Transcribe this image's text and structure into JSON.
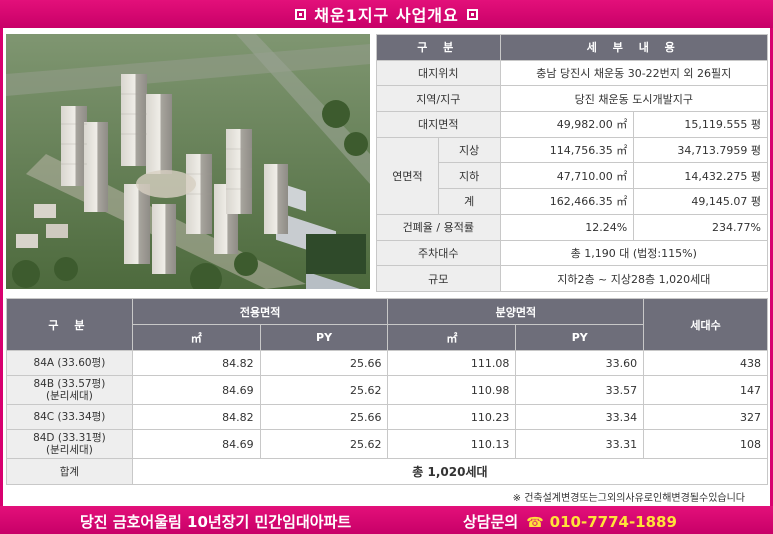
{
  "header": {
    "title": "채운1지구 사업개요"
  },
  "spec": {
    "head_label": "구 분",
    "head_content": "세 부 내 용",
    "location_label": "대지위치",
    "location_value": "충남 당진시 채운동 30-22번지 외 26필지",
    "district_label": "지역/지구",
    "district_value": "당진 채운동 도시개발지구",
    "site_area_label": "대지면적",
    "site_area_m2": "49,982.00 ㎡",
    "site_area_py": "15,119.555 평",
    "gfa_label": "연면적",
    "above_label": "지상",
    "above_m2": "114,756.35 ㎡",
    "above_py": "34,713.7959 평",
    "below_label": "지하",
    "below_m2": "47,710.00 ㎡",
    "below_py": "14,432.275 평",
    "sum_label": "계",
    "sum_m2": "162,466.35 ㎡",
    "sum_py": "49,145.07 평",
    "ratio_label": "건폐율 / 용적률",
    "coverage": "12.24%",
    "far": "234.77%",
    "parking_label": "주차대수",
    "parking_value": "총 1,190 대 (법정:115%)",
    "scale_label": "규모",
    "scale_value": "지하2층 ~ 지상28층  1,020세대"
  },
  "units": {
    "head_label": "구 분",
    "exclusive_label": "전용면적",
    "supply_label": "분양면적",
    "households_label": "세대수",
    "m2_label": "㎡",
    "py_label": "PY",
    "rows": [
      {
        "type_line1": "84A (33.60평)",
        "type_line2": "",
        "ex_m2": "84.82",
        "ex_py": "25.66",
        "su_m2": "111.08",
        "su_py": "33.60",
        "households": "438"
      },
      {
        "type_line1": "84B (33.57평)",
        "type_line2": "(분리세대)",
        "ex_m2": "84.69",
        "ex_py": "25.62",
        "su_m2": "110.98",
        "su_py": "33.57",
        "households": "147"
      },
      {
        "type_line1": "84C (33.34평)",
        "type_line2": "",
        "ex_m2": "84.82",
        "ex_py": "25.66",
        "su_m2": "110.23",
        "su_py": "33.34",
        "households": "327"
      },
      {
        "type_line1": "84D (33.31평)",
        "type_line2": "(분리세대)",
        "ex_m2": "84.69",
        "ex_py": "25.62",
        "su_m2": "110.13",
        "su_py": "33.31",
        "households": "108"
      }
    ],
    "total_label": "합계",
    "total_value": "총 1,020세대"
  },
  "note": "※ 건축설계변경또는그외의사유로인해변경될수있습니다",
  "footer": {
    "left_text": "당진 금호어울림 10년장기 민간임대아파트",
    "contact_label": "상담문의",
    "phone_icon": "☎",
    "phone": "010-7774-1889"
  },
  "colors": {
    "accent": "#d8006f",
    "table_header": "#6e6e7a",
    "label_bg": "#eeeeee"
  }
}
